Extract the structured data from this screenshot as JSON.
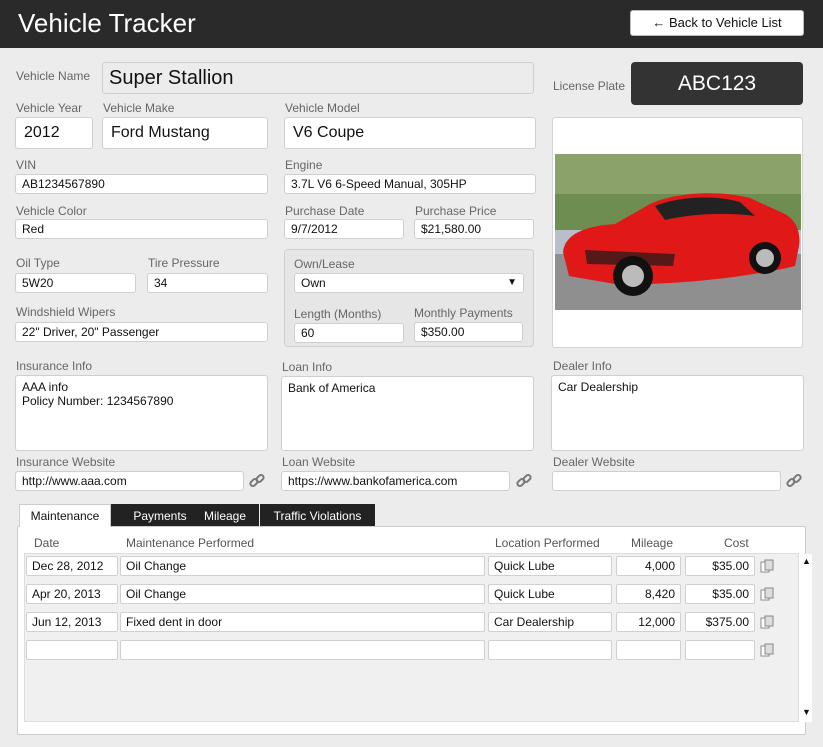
{
  "app": {
    "title": "Vehicle Tracker",
    "back_label": "← Back to Vehicle List"
  },
  "vehicle": {
    "name_label": "Vehicle Name",
    "name": "Super Stallion",
    "plate_label": "License Plate",
    "plate": "ABC123",
    "year_label": "Vehicle Year",
    "year": "2012",
    "make_label": "Vehicle Make",
    "make": "Ford Mustang",
    "model_label": "Vehicle Model",
    "model": "V6 Coupe",
    "vin_label": "VIN",
    "vin": "AB1234567890",
    "engine_label": "Engine",
    "engine": "3.7L V6 6-Speed Manual, 305HP",
    "color_label": "Vehicle Color",
    "color": "Red",
    "purchase_date_label": "Purchase Date",
    "purchase_date": "9/7/2012",
    "purchase_price_label": "Purchase Price",
    "purchase_price": "$21,580.00",
    "oil_label": "Oil Type",
    "oil": "5W20",
    "tire_label": "Tire Pressure",
    "tire": "34",
    "wipers_label": "Windshield Wipers",
    "wipers": "22\" Driver, 20\" Passenger",
    "own_lease_label": "Own/Lease",
    "own_lease": "Own",
    "length_label": "Length (Months)",
    "length": "60",
    "monthly_label": "Monthly Payments",
    "monthly": "$350.00",
    "insurance_label": "Insurance Info",
    "insurance": "AAA info\nPolicy Number: 1234567890",
    "loan_label": "Loan Info",
    "loan": "Bank of America",
    "dealer_label": "Dealer Info",
    "dealer": "Car Dealership",
    "ins_web_label": "Insurance Website",
    "ins_web": "http://www.aaa.com",
    "loan_web_label": "Loan Website",
    "loan_web": "https://www.bankofamerica.com",
    "dealer_web_label": "Dealer Website",
    "dealer_web": ""
  },
  "tabs": [
    "Maintenance",
    "Payments",
    "Mileage",
    "Traffic Violations"
  ],
  "maintenance": {
    "headers": [
      "Date",
      "Maintenance Performed",
      "Location Performed",
      "Mileage",
      "Cost"
    ],
    "rows": [
      [
        "Dec 28, 2012",
        "Oil Change",
        "Quick Lube",
        "4,000",
        "$35.00"
      ],
      [
        "Apr 20, 2013",
        "Oil Change",
        "Quick Lube",
        "8,420",
        "$35.00"
      ],
      [
        "Jun 12, 2013",
        "Fixed dent in door",
        "Car Dealership",
        "12,000",
        "$375.00"
      ],
      [
        "",
        "",
        "",
        "",
        ""
      ]
    ]
  },
  "colors": {
    "header": "#2a2a2a",
    "car": "#e01818"
  }
}
